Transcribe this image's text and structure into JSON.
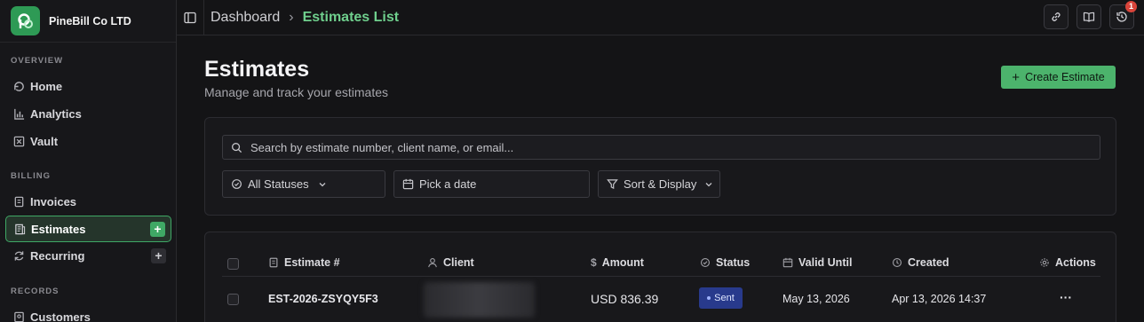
{
  "brand": {
    "name": "PineBill Co LTD",
    "accent": "#2e9a55"
  },
  "sidebar": {
    "sections": [
      {
        "title": "OVERVIEW"
      },
      {
        "title": "BILLING"
      },
      {
        "title": "RECORDS"
      }
    ],
    "items": [
      {
        "label": "Home",
        "icon": "home-icon"
      },
      {
        "label": "Analytics",
        "icon": "bar-chart-icon"
      },
      {
        "label": "Vault",
        "icon": "vault-icon"
      },
      {
        "label": "Invoices",
        "icon": "document-icon"
      },
      {
        "label": "Estimates",
        "icon": "receipt-icon",
        "active": true
      },
      {
        "label": "Recurring",
        "icon": "refresh-icon"
      },
      {
        "label": "Customers",
        "icon": "contacts-icon"
      }
    ],
    "plus_label": "+"
  },
  "topbar": {
    "breadcrumb_root": "Dashboard",
    "breadcrumb_sep": "›",
    "breadcrumb_current": "Estimates List",
    "notification_count": "1",
    "icons": [
      "link-icon",
      "book-icon",
      "history-icon"
    ]
  },
  "main": {
    "title": "Estimates",
    "subtitle": "Manage and track your estimates",
    "create_button": "Create Estimate",
    "create_plus": "+"
  },
  "filters": {
    "search_placeholder": "Search by estimate number, client name, or email...",
    "status_label": "All Statuses",
    "date_label": "Pick a date",
    "sort_label": "Sort & Display"
  },
  "table": {
    "columns": [
      {
        "label": "Estimate #",
        "icon": "document-icon"
      },
      {
        "label": "Client",
        "icon": "user-icon"
      },
      {
        "label": "Amount",
        "icon": "dollar-icon"
      },
      {
        "label": "Status",
        "icon": "check-circle-icon"
      },
      {
        "label": "Valid Until",
        "icon": "calendar-icon"
      },
      {
        "label": "Created",
        "icon": "clock-icon"
      },
      {
        "label": "Actions",
        "icon": "gear-icon"
      }
    ],
    "rows": [
      {
        "estimate": "EST-2026-ZSYQY5F3",
        "amount": "USD 836.39",
        "status": "Sent",
        "valid_until": "May 13, 2026",
        "created": "Apr 13, 2026 14:37",
        "actions": "···"
      }
    ]
  },
  "colors": {
    "status_sent": "#283a8c",
    "primary_button": "#4cb36c",
    "breadcrumb_current": "#6fcf8d"
  }
}
